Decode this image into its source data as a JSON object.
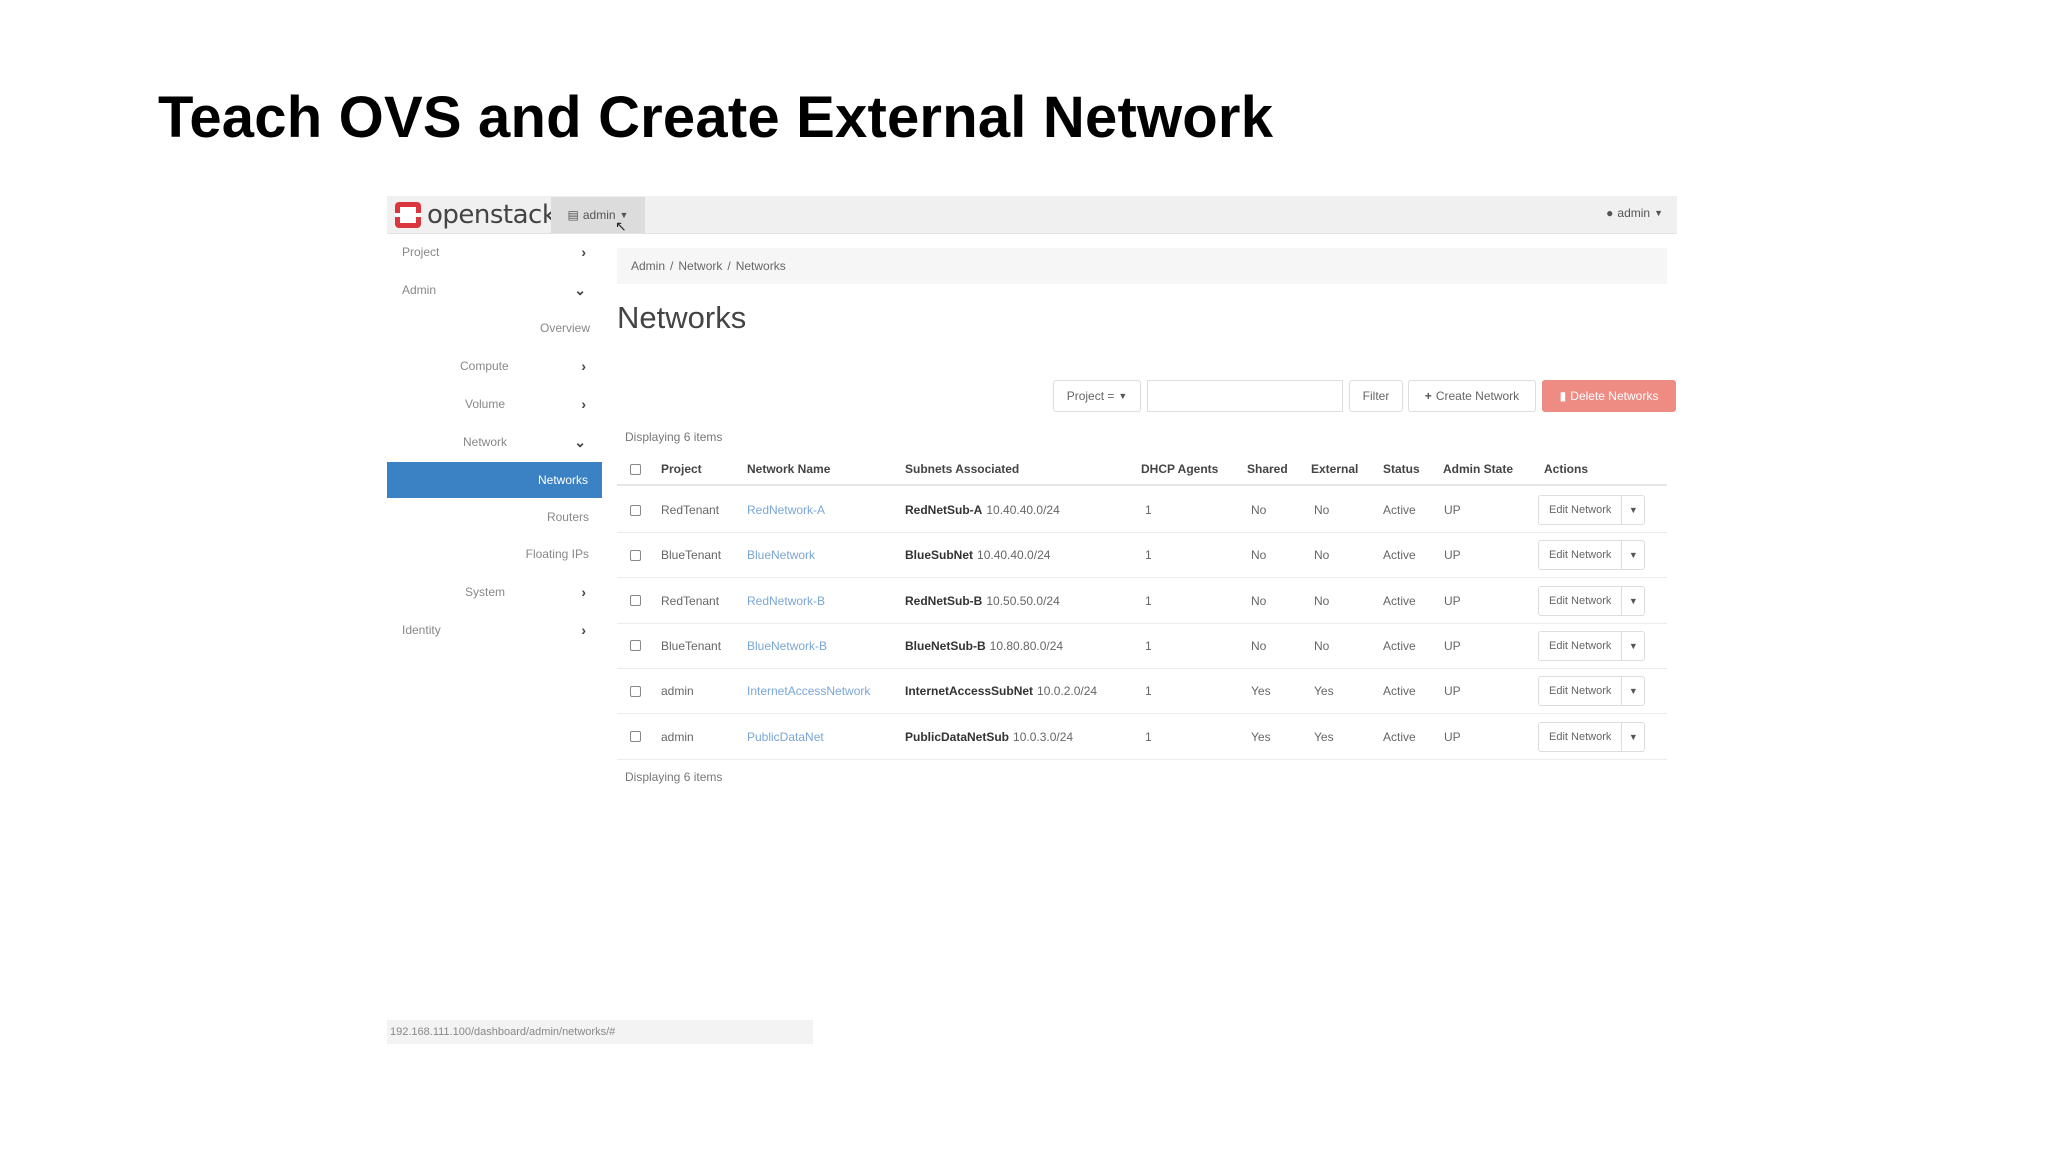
{
  "slide": {
    "title": "Teach OVS and Create External Network"
  },
  "topbar": {
    "logo_text": "openstack.",
    "project_dropdown": "admin",
    "user_dropdown": "admin"
  },
  "sidebar": {
    "items": [
      {
        "label": "Project"
      },
      {
        "label": "Admin"
      },
      {
        "label": "Overview"
      },
      {
        "label": "Compute"
      },
      {
        "label": "Volume"
      },
      {
        "label": "Network"
      },
      {
        "label": "Networks"
      },
      {
        "label": "Routers"
      },
      {
        "label": "Floating IPs"
      },
      {
        "label": "System"
      },
      {
        "label": "Identity"
      }
    ]
  },
  "breadcrumb": [
    "Admin",
    "Network",
    "Networks"
  ],
  "page_title": "Networks",
  "toolbar": {
    "filter_select": "Project =",
    "filter_value": "",
    "filter_button": "Filter",
    "create_button": "Create Network",
    "delete_button": "Delete Networks"
  },
  "table": {
    "displaying_top": "Displaying 6 items",
    "displaying_bottom": "Displaying 6 items",
    "headers": [
      "Project",
      "Network Name",
      "Subnets Associated",
      "DHCP Agents",
      "Shared",
      "External",
      "Status",
      "Admin State",
      "Actions"
    ],
    "rows": [
      {
        "project": "RedTenant",
        "name": "RedNetwork-A",
        "subnet_name": "RedNetSub-A",
        "subnet_cidr": "10.40.40.0/24",
        "dhcp": "1",
        "shared": "No",
        "external": "No",
        "status": "Active",
        "admin_state": "UP",
        "action": "Edit Network"
      },
      {
        "project": "BlueTenant",
        "name": "BlueNetwork",
        "subnet_name": "BlueSubNet",
        "subnet_cidr": "10.40.40.0/24",
        "dhcp": "1",
        "shared": "No",
        "external": "No",
        "status": "Active",
        "admin_state": "UP",
        "action": "Edit Network"
      },
      {
        "project": "RedTenant",
        "name": "RedNetwork-B",
        "subnet_name": "RedNetSub-B",
        "subnet_cidr": "10.50.50.0/24",
        "dhcp": "1",
        "shared": "No",
        "external": "No",
        "status": "Active",
        "admin_state": "UP",
        "action": "Edit Network"
      },
      {
        "project": "BlueTenant",
        "name": "BlueNetwork-B",
        "subnet_name": "BlueNetSub-B",
        "subnet_cidr": "10.80.80.0/24",
        "dhcp": "1",
        "shared": "No",
        "external": "No",
        "status": "Active",
        "admin_state": "UP",
        "action": "Edit Network"
      },
      {
        "project": "admin",
        "name": "InternetAccessNetwork",
        "subnet_name": "InternetAccessSubNet",
        "subnet_cidr": "10.0.2.0/24",
        "dhcp": "1",
        "shared": "Yes",
        "external": "Yes",
        "status": "Active",
        "admin_state": "UP",
        "action": "Edit Network"
      },
      {
        "project": "admin",
        "name": "PublicDataNet",
        "subnet_name": "PublicDataNetSub",
        "subnet_cidr": "10.0.3.0/24",
        "dhcp": "1",
        "shared": "Yes",
        "external": "Yes",
        "status": "Active",
        "admin_state": "UP",
        "action": "Edit Network"
      }
    ]
  },
  "statusbar": {
    "url": "192.168.111.100/dashboard/admin/networks/#"
  },
  "colors": {
    "accent": "#3b82c4",
    "danger": "#ee8c84",
    "brand": "#d9363e",
    "link": "#7aa6d6"
  }
}
